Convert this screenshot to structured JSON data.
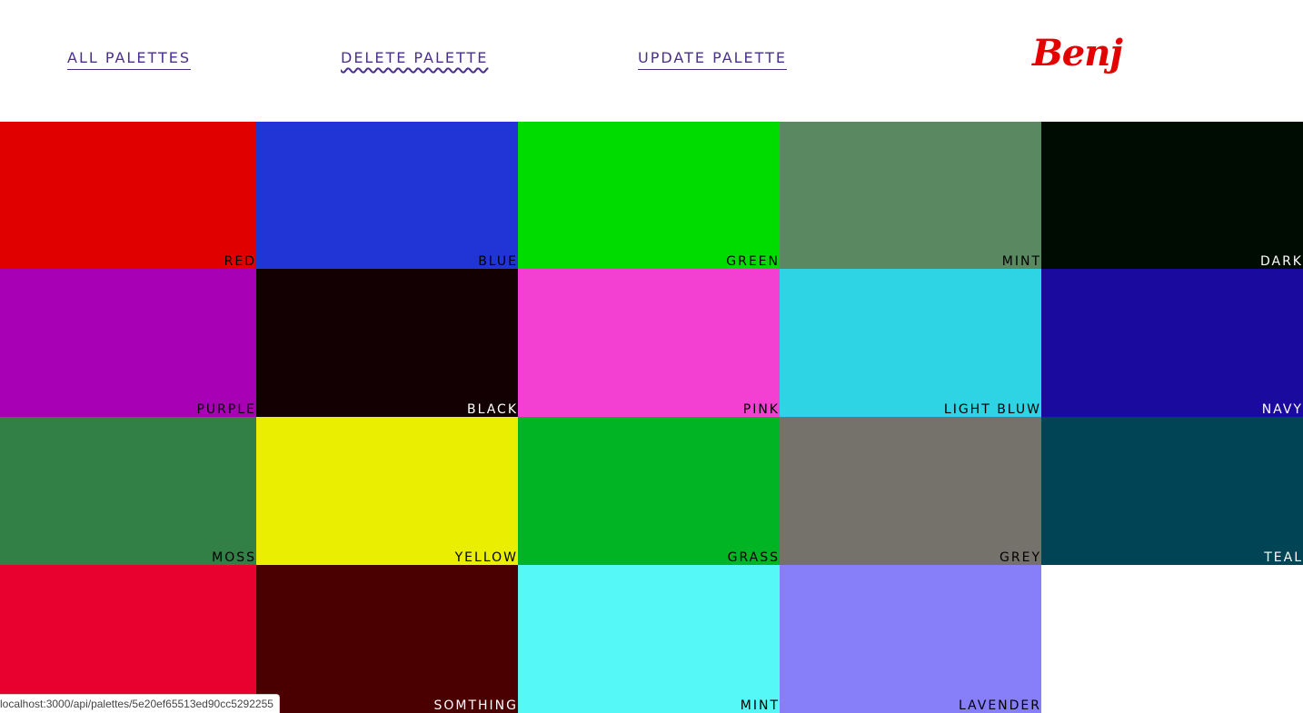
{
  "header": {
    "links": {
      "all_palettes": "ALL PALETTES",
      "delete_palette": "DELETE PALETTE",
      "update_palette": "UPDATE PALETTE"
    },
    "palette_name": "Benj",
    "colors": {
      "link": "#4a2f8f",
      "palette_name": "#e50000"
    }
  },
  "swatches": [
    {
      "name": "RED",
      "color": "#e00000",
      "label_color": "#000000"
    },
    {
      "name": "BLUE",
      "color": "#2135d6",
      "label_color": "#000000"
    },
    {
      "name": "GREEN",
      "color": "#00dc00",
      "label_color": "#000000"
    },
    {
      "name": "MINT",
      "color": "#5a8860",
      "label_color": "#000000"
    },
    {
      "name": "DARK",
      "color": "#000c02",
      "label_color": "#ffffff"
    },
    {
      "name": "PURPLE",
      "color": "#a800b4",
      "label_color": "#000000"
    },
    {
      "name": "BLACK",
      "color": "#130002",
      "label_color": "#ffffff"
    },
    {
      "name": "PINK",
      "color": "#f43fd3",
      "label_color": "#000000"
    },
    {
      "name": "LIGHT BLUW",
      "color": "#2ed4e4",
      "label_color": "#000000"
    },
    {
      "name": "NAVY",
      "color": "#1a0b9e",
      "label_color": "#ffffff"
    },
    {
      "name": "MOSS",
      "color": "#328046",
      "label_color": "#000000"
    },
    {
      "name": "YELLOW",
      "color": "#eaee00",
      "label_color": "#000000"
    },
    {
      "name": "GRASS",
      "color": "#00b424",
      "label_color": "#000000"
    },
    {
      "name": "GREY",
      "color": "#75726b",
      "label_color": "#000000"
    },
    {
      "name": "TEAL",
      "color": "#004456",
      "label_color": "#ffffff"
    },
    {
      "name": "",
      "color": "#e8002e",
      "label_color": "#000000"
    },
    {
      "name": "SOMTHING",
      "color": "#4a0000",
      "label_color": "#ffffff"
    },
    {
      "name": "MINT",
      "color": "#55f8f6",
      "label_color": "#000000"
    },
    {
      "name": "LAVENDER",
      "color": "#877ffa",
      "label_color": "#000000"
    }
  ],
  "status_bar": {
    "url": "localhost:3000/api/palettes/5e20ef65513ed90cc5292255"
  }
}
